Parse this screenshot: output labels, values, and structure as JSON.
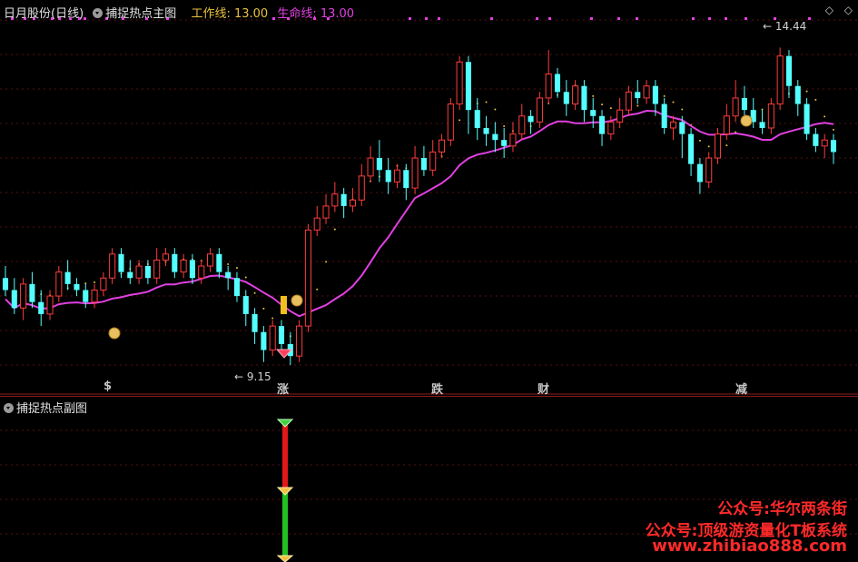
{
  "header": {
    "title": "日月股份(日线)",
    "indicator_name": "捕捉热点主图",
    "work_line_label": "工作线: 13.00",
    "life_line_label": "生命线: 13.00"
  },
  "corner": {
    "diamond_icon": "◇",
    "expand_icon": "◇"
  },
  "price_high_label": "14.44",
  "price_low_label": "9.15",
  "signals": [
    {
      "text": "$",
      "color": "#ff3030"
    },
    {
      "text": "涨",
      "color": "#ff3030"
    },
    {
      "text": "跌",
      "color": "#30d030"
    },
    {
      "text": "财",
      "color": "#4aa8ff"
    },
    {
      "text": "减",
      "color": "#30d030"
    }
  ],
  "sub_panel": {
    "title": "捕捉热点副图"
  },
  "watermark": {
    "line1": "公众号:华尔两条街",
    "line2": "公众号:顶级游资量化T板系统",
    "line3": "www.zhibiao888.com"
  },
  "colors": {
    "up": "#ff3c3c",
    "down": "#54ffff",
    "work_line": "#e8c040",
    "life_line": "#e040e0",
    "grid": "#5a1010",
    "divider": "#8a1c1c"
  },
  "chart_data": {
    "type": "candlestick",
    "ohlc": [
      [
        10.6,
        10.4,
        10.8,
        10.3
      ],
      [
        10.4,
        10.1,
        10.6,
        10.0
      ],
      [
        10.1,
        10.5,
        10.6,
        9.9
      ],
      [
        10.5,
        10.2,
        10.7,
        10.1
      ],
      [
        10.2,
        10.0,
        10.4,
        9.8
      ],
      [
        10.0,
        10.3,
        10.4,
        9.9
      ],
      [
        10.3,
        10.7,
        10.8,
        10.2
      ],
      [
        10.7,
        10.5,
        10.9,
        10.4
      ],
      [
        10.5,
        10.4,
        10.6,
        10.3
      ],
      [
        10.4,
        10.2,
        10.5,
        10.1
      ],
      [
        10.2,
        10.4,
        10.5,
        10.1
      ],
      [
        10.4,
        10.6,
        10.7,
        10.3
      ],
      [
        10.6,
        11.0,
        11.1,
        10.5
      ],
      [
        11.0,
        10.7,
        11.1,
        10.6
      ],
      [
        10.7,
        10.6,
        10.9,
        10.5
      ],
      [
        10.6,
        10.8,
        10.9,
        10.5
      ],
      [
        10.8,
        10.6,
        10.9,
        10.5
      ],
      [
        10.6,
        10.9,
        11.1,
        10.5
      ],
      [
        10.9,
        11.0,
        11.1,
        10.8
      ],
      [
        11.0,
        10.7,
        11.1,
        10.6
      ],
      [
        10.7,
        10.9,
        11.0,
        10.6
      ],
      [
        10.9,
        10.6,
        11.0,
        10.5
      ],
      [
        10.6,
        10.8,
        10.9,
        10.5
      ],
      [
        10.8,
        11.0,
        11.1,
        10.7
      ],
      [
        11.0,
        10.7,
        11.1,
        10.6
      ],
      [
        10.7,
        10.6,
        10.8,
        10.4
      ],
      [
        10.6,
        10.3,
        10.7,
        10.2
      ],
      [
        10.3,
        10.0,
        10.4,
        9.8
      ],
      [
        10.0,
        9.7,
        10.1,
        9.5
      ],
      [
        9.7,
        9.4,
        9.8,
        9.2
      ],
      [
        9.4,
        9.8,
        9.9,
        9.3
      ],
      [
        9.8,
        9.5,
        9.9,
        9.4
      ],
      [
        9.5,
        9.3,
        9.7,
        9.15
      ],
      [
        9.3,
        9.8,
        9.9,
        9.2
      ],
      [
        9.8,
        11.4,
        11.5,
        9.7
      ],
      [
        11.4,
        11.6,
        11.8,
        11.3
      ],
      [
        11.6,
        11.8,
        12.0,
        11.5
      ],
      [
        11.8,
        12.0,
        12.2,
        11.7
      ],
      [
        12.0,
        11.8,
        12.1,
        11.6
      ],
      [
        11.8,
        11.9,
        12.1,
        11.7
      ],
      [
        11.9,
        12.3,
        12.5,
        11.8
      ],
      [
        12.3,
        12.6,
        12.8,
        12.2
      ],
      [
        12.6,
        12.4,
        12.9,
        12.2
      ],
      [
        12.4,
        12.2,
        12.6,
        12.0
      ],
      [
        12.2,
        12.4,
        12.5,
        12.1
      ],
      [
        12.4,
        12.1,
        12.5,
        11.9
      ],
      [
        12.1,
        12.6,
        12.8,
        12.0
      ],
      [
        12.6,
        12.4,
        12.8,
        12.3
      ],
      [
        12.4,
        12.7,
        12.9,
        12.3
      ],
      [
        12.7,
        12.9,
        13.0,
        12.6
      ],
      [
        12.9,
        13.5,
        13.6,
        12.8
      ],
      [
        13.5,
        14.2,
        14.3,
        13.4
      ],
      [
        14.2,
        13.4,
        14.3,
        13.0
      ],
      [
        13.4,
        13.1,
        13.6,
        12.9
      ],
      [
        13.1,
        13.0,
        13.3,
        12.8
      ],
      [
        13.0,
        12.9,
        13.2,
        12.7
      ],
      [
        12.9,
        12.8,
        13.1,
        12.6
      ],
      [
        12.8,
        13.0,
        13.2,
        12.7
      ],
      [
        13.0,
        13.3,
        13.5,
        12.9
      ],
      [
        13.3,
        13.2,
        13.4,
        13.0
      ],
      [
        13.2,
        13.6,
        13.7,
        13.1
      ],
      [
        13.6,
        14.0,
        14.4,
        13.5
      ],
      [
        14.0,
        13.7,
        14.1,
        13.6
      ],
      [
        13.7,
        13.5,
        13.9,
        13.3
      ],
      [
        13.5,
        13.8,
        13.9,
        13.4
      ],
      [
        13.8,
        13.4,
        13.9,
        13.2
      ],
      [
        13.4,
        13.3,
        13.6,
        13.1
      ],
      [
        13.3,
        13.0,
        13.4,
        12.8
      ],
      [
        13.0,
        13.2,
        13.3,
        12.9
      ],
      [
        13.2,
        13.4,
        13.6,
        13.1
      ],
      [
        13.4,
        13.7,
        13.8,
        13.3
      ],
      [
        13.7,
        13.6,
        13.9,
        13.5
      ],
      [
        13.6,
        13.8,
        13.9,
        13.5
      ],
      [
        13.8,
        13.5,
        13.9,
        13.3
      ],
      [
        13.5,
        13.1,
        13.6,
        13.0
      ],
      [
        13.1,
        13.2,
        13.3,
        12.9
      ],
      [
        13.2,
        13.0,
        13.3,
        12.6
      ],
      [
        13.0,
        12.5,
        13.1,
        12.3
      ],
      [
        12.5,
        12.2,
        12.6,
        12.0
      ],
      [
        12.2,
        12.6,
        12.7,
        12.1
      ],
      [
        12.6,
        13.0,
        13.1,
        12.5
      ],
      [
        13.0,
        13.3,
        13.5,
        12.9
      ],
      [
        13.3,
        13.6,
        13.9,
        13.2
      ],
      [
        13.6,
        13.4,
        13.8,
        13.3
      ],
      [
        13.4,
        13.2,
        13.6,
        13.1
      ],
      [
        13.2,
        13.1,
        13.4,
        13.0
      ],
      [
        13.1,
        13.5,
        13.6,
        13.0
      ],
      [
        13.5,
        14.3,
        14.44,
        13.4
      ],
      [
        14.3,
        13.8,
        14.4,
        13.6
      ],
      [
        13.8,
        13.5,
        13.9,
        13.3
      ],
      [
        13.5,
        13.0,
        13.6,
        12.9
      ],
      [
        13.0,
        12.8,
        13.1,
        12.7
      ],
      [
        12.8,
        12.9,
        13.0,
        12.6
      ],
      [
        12.9,
        12.7,
        13.0,
        12.5
      ]
    ],
    "ylim": [
      9.0,
      14.9
    ]
  }
}
